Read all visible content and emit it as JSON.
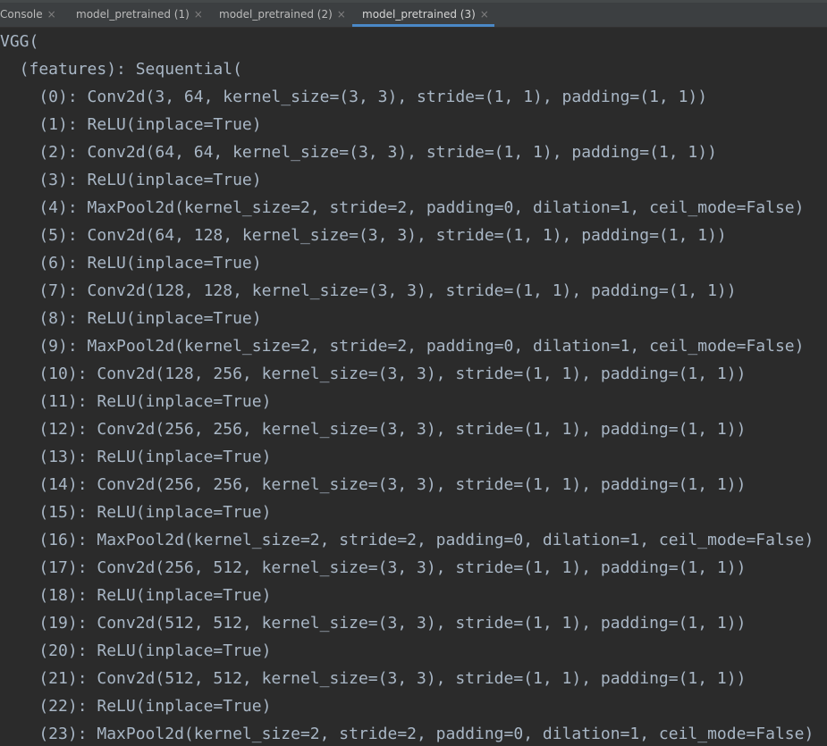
{
  "tabs": [
    {
      "label": "Console",
      "close": "×",
      "active": false
    },
    {
      "label": "model_pretrained (1)",
      "close": "×",
      "active": false
    },
    {
      "label": "model_pretrained (2)",
      "close": "×",
      "active": false
    },
    {
      "label": "model_pretrained (3)",
      "close": "×",
      "active": true
    }
  ],
  "colors": {
    "background": "#2b2b2b",
    "text": "#a9b7c6",
    "tab_bar": "#3c3f41",
    "active_tab_underline": "#4a88c7"
  },
  "lines": [
    "VGG(",
    "  (features): Sequential(",
    "    (0): Conv2d(3, 64, kernel_size=(3, 3), stride=(1, 1), padding=(1, 1))",
    "    (1): ReLU(inplace=True)",
    "    (2): Conv2d(64, 64, kernel_size=(3, 3), stride=(1, 1), padding=(1, 1))",
    "    (3): ReLU(inplace=True)",
    "    (4): MaxPool2d(kernel_size=2, stride=2, padding=0, dilation=1, ceil_mode=False)",
    "    (5): Conv2d(64, 128, kernel_size=(3, 3), stride=(1, 1), padding=(1, 1))",
    "    (6): ReLU(inplace=True)",
    "    (7): Conv2d(128, 128, kernel_size=(3, 3), stride=(1, 1), padding=(1, 1))",
    "    (8): ReLU(inplace=True)",
    "    (9): MaxPool2d(kernel_size=2, stride=2, padding=0, dilation=1, ceil_mode=False)",
    "    (10): Conv2d(128, 256, kernel_size=(3, 3), stride=(1, 1), padding=(1, 1))",
    "    (11): ReLU(inplace=True)",
    "    (12): Conv2d(256, 256, kernel_size=(3, 3), stride=(1, 1), padding=(1, 1))",
    "    (13): ReLU(inplace=True)",
    "    (14): Conv2d(256, 256, kernel_size=(3, 3), stride=(1, 1), padding=(1, 1))",
    "    (15): ReLU(inplace=True)",
    "    (16): MaxPool2d(kernel_size=2, stride=2, padding=0, dilation=1, ceil_mode=False)",
    "    (17): Conv2d(256, 512, kernel_size=(3, 3), stride=(1, 1), padding=(1, 1))",
    "    (18): ReLU(inplace=True)",
    "    (19): Conv2d(512, 512, kernel_size=(3, 3), stride=(1, 1), padding=(1, 1))",
    "    (20): ReLU(inplace=True)",
    "    (21): Conv2d(512, 512, kernel_size=(3, 3), stride=(1, 1), padding=(1, 1))",
    "    (22): ReLU(inplace=True)",
    "    (23): MaxPool2d(kernel_size=2, stride=2, padding=0, dilation=1, ceil_mode=False)"
  ]
}
